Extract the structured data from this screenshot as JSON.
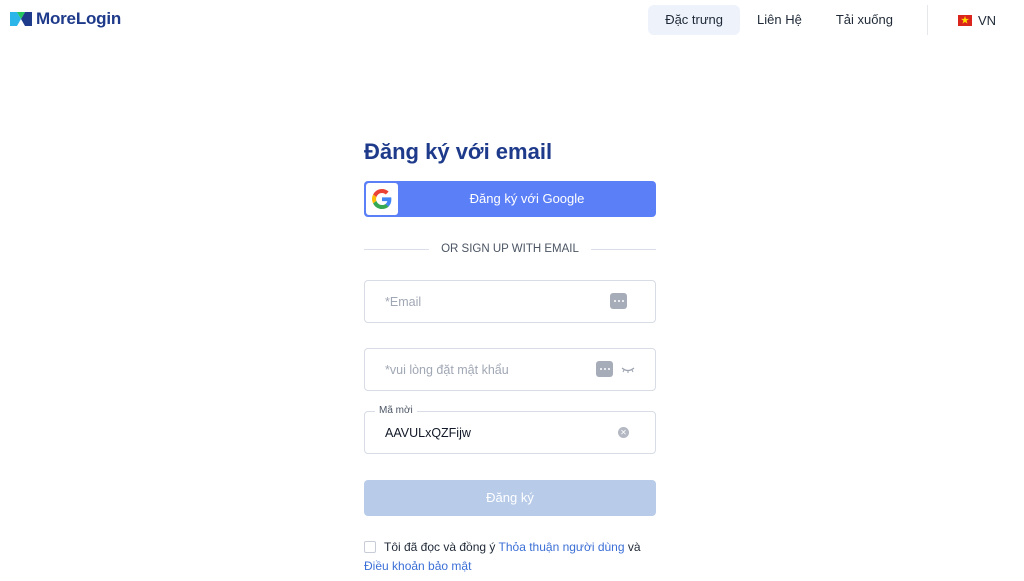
{
  "brand": {
    "name": "MoreLogin"
  },
  "nav": {
    "items": [
      {
        "label": "Đặc trưng",
        "active": true
      },
      {
        "label": "Liên Hệ",
        "active": false
      },
      {
        "label": "Tải xuống",
        "active": false
      }
    ],
    "language": {
      "label": "VN",
      "flag_icon": "vietnam-flag-icon"
    }
  },
  "form": {
    "title": "Đăng ký với email",
    "google_button": "Đăng ký với Google",
    "divider_text": "OR SIGN UP WITH EMAIL",
    "email": {
      "placeholder": "*Email",
      "value": ""
    },
    "password": {
      "placeholder": "*vui lòng đặt mật khẩu",
      "value": ""
    },
    "invite_code": {
      "label": "Mã mời",
      "value": "AAVULxQZFijw"
    },
    "submit": "Đăng ký",
    "terms": {
      "prefix": "Tôi đã đọc và đồng ý",
      "user_agreement": "Thỏa thuận người dùng",
      "and": "và",
      "privacy": "Điều khoản bảo mật"
    }
  },
  "colors": {
    "brand_blue": "#1e3a8a",
    "google_button": "#5b7ff7",
    "submit_disabled": "#b8cbe9",
    "link": "#3b6fd6"
  }
}
